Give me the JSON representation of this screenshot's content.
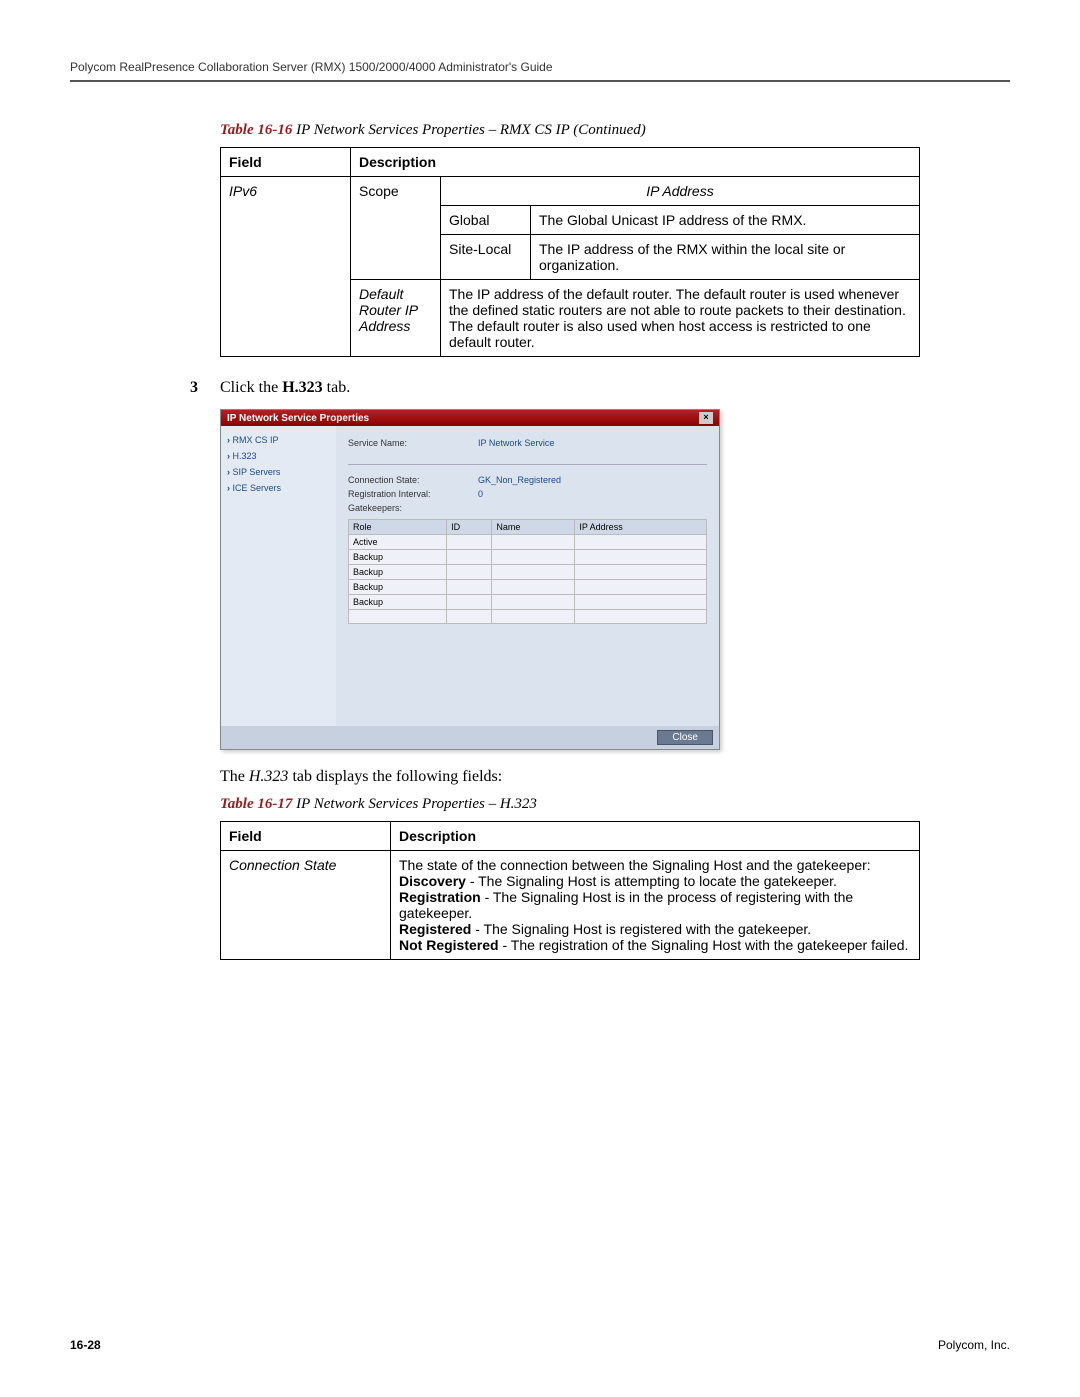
{
  "header": "Polycom RealPresence Collaboration Server (RMX) 1500/2000/4000 Administrator's Guide",
  "table16": {
    "caption_no": "Table 16-16",
    "caption_text": "IP Network Services Properties – RMX CS IP (Continued)",
    "header_field": "Field",
    "header_desc": "Description",
    "ipv6_label": "IPv6",
    "scope_label": "Scope",
    "ipaddr_label": "IP Address",
    "global_label": "Global",
    "global_desc": "The Global Unicast IP address of the RMX.",
    "sitelocal_label": "Site-Local",
    "sitelocal_desc": "The IP address of the RMX within the local site or organization.",
    "defrouter_label": "Default Router IP Address",
    "defrouter_desc": "The IP address of the default router. The default router is used whenever the defined static routers are not able to route packets to their destination. The default router is also used when host access is restricted to one default router."
  },
  "step3": {
    "num": "3",
    "prefix": "Click the ",
    "bold": "H.323",
    "suffix": " tab."
  },
  "dialog": {
    "title": "IP Network Service Properties",
    "nav": [
      "RMX CS IP",
      "H.323",
      "SIP Servers",
      "ICE Servers"
    ],
    "service_name_label": "Service Name:",
    "service_name_value": "IP Network Service",
    "conn_state_label": "Connection State:",
    "conn_state_value": "GK_Non_Registered",
    "reg_int_label": "Registration Interval:",
    "reg_int_value": "0",
    "gatekeepers_label": "Gatekeepers:",
    "gk_headers": [
      "Role",
      "ID",
      "Name",
      "IP Address"
    ],
    "gk_rows": [
      "Active",
      "Backup",
      "Backup",
      "Backup",
      "Backup"
    ],
    "close": "Close"
  },
  "body_text_prefix": "The ",
  "body_text_italic": "H.323",
  "body_text_suffix": " tab displays the following fields:",
  "table17": {
    "caption_no": "Table 16-17",
    "caption_text": "IP Network Services Properties – H.323",
    "header_field": "Field",
    "header_desc": "Description",
    "conn_state": "Connection State",
    "desc_intro": "The state of the connection between the Signaling Host and the gatekeeper:",
    "discovery_b": "Discovery",
    "discovery_t": " - The Signaling Host is attempting to locate the gatekeeper.",
    "registration_b": "Registration",
    "registration_t": " - The Signaling Host is in the process of registering with the gatekeeper.",
    "registered_b": "Registered",
    "registered_t": " - The Signaling Host is registered with the gatekeeper.",
    "notreg_b": "Not Registered",
    "notreg_t": " - The registration of the Signaling Host with the gatekeeper failed."
  },
  "footer": {
    "left": "16-28",
    "right": "Polycom, Inc."
  }
}
